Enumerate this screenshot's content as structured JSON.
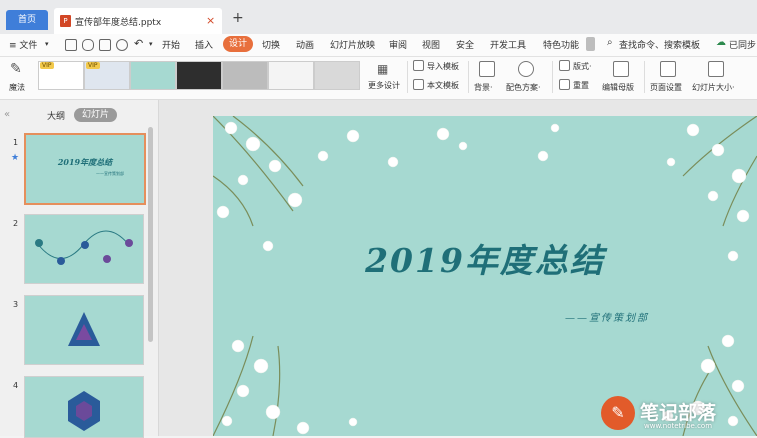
{
  "tabs": {
    "home": "首页",
    "document": "宣传部年度总结.pptx",
    "close": "×",
    "new": "+"
  },
  "menu": {
    "file": "≡ 文件",
    "items": [
      "开始",
      "插入",
      "设计",
      "切换",
      "动画",
      "幻灯片放映",
      "审阅",
      "视图",
      "安全",
      "开发工具",
      "特色功能"
    ],
    "active_index": 2,
    "search": "查找命令、搜索模板",
    "sync": "已同步"
  },
  "ribbon": {
    "magic": "魔法",
    "vip": "VIP",
    "more_design": "更多设计",
    "import_template": "导入模板",
    "text_template": "本文模板",
    "background": "背景·",
    "color_scheme": "配色方案·",
    "layout": "版式·",
    "reset": "重置",
    "edit_master": "编辑母版",
    "page_setup": "页面设置",
    "slide_size": "幻灯片大小·"
  },
  "panel": {
    "outline": "大纲",
    "slides": "幻灯片",
    "thumbnails": [
      {
        "num": "1",
        "title": "2019年度总结",
        "sub": "——宣传策划部"
      },
      {
        "num": "2"
      },
      {
        "num": "3"
      },
      {
        "num": "4"
      }
    ]
  },
  "slide": {
    "title": "2019年度总结",
    "subtitle": "——宣传策划部"
  },
  "watermark": {
    "text": "笔记部落",
    "url": "www.notetribe.com"
  },
  "colors": {
    "accent": "#e86f3c",
    "home_tab": "#3f7ed9",
    "slide_bg": "#a6d9d1",
    "title": "#1f6f78"
  }
}
